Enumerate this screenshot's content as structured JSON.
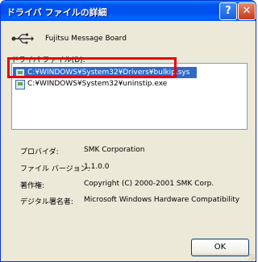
{
  "window": {
    "title": "ドライバ ファイルの詳細"
  },
  "device_name": "Fujitsu Message Board",
  "files_label": "ドライバ ファイル(D):",
  "files": [
    "C:¥WINDOWS¥System32¥Drivers¥bulkip.sys",
    "C:¥WINDOWS¥System32¥uninstip.exe"
  ],
  "details": {
    "provider_label": "プロバイダ:",
    "provider_value": "SMK Corporation",
    "version_label": "ファイル バージョン:",
    "version_value": "1.1.0.0",
    "copyright_label": "著作権:",
    "copyright_value": "Copyright (C) 2000-2001 SMK Corp.",
    "signer_label": "デジタル署名者:",
    "signer_value": "Microsoft Windows Hardware Compatibility"
  },
  "buttons": {
    "ok": "OK",
    "help": "?",
    "close": "✕"
  },
  "colors": {
    "title_bar": "#0054e3",
    "selection": "#316ac5",
    "highlight_box": "#e60012"
  }
}
